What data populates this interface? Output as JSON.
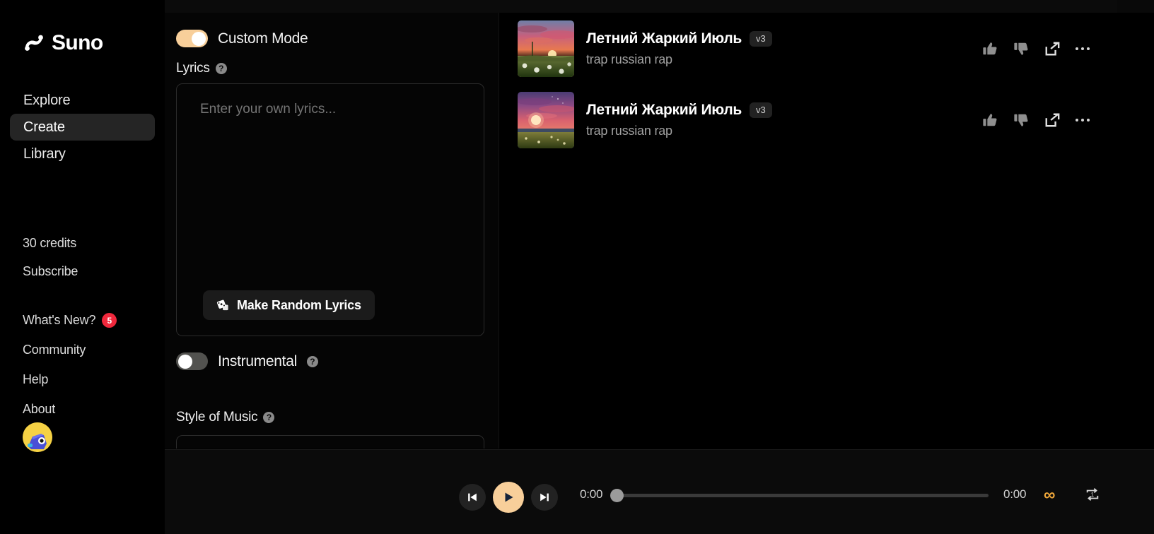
{
  "app": {
    "brand": "Suno"
  },
  "sidebar": {
    "nav": [
      {
        "label": "Explore",
        "active": false,
        "name": "explore"
      },
      {
        "label": "Create",
        "active": true,
        "name": "create"
      },
      {
        "label": "Library",
        "active": false,
        "name": "library"
      }
    ],
    "credits": "30 credits",
    "subscribe": "Subscribe",
    "links": [
      {
        "label": "What's New?",
        "badge": "5"
      },
      {
        "label": "Community",
        "badge": null
      },
      {
        "label": "Help",
        "badge": null
      },
      {
        "label": "About",
        "badge": null
      }
    ]
  },
  "create": {
    "custom_mode_label": "Custom Mode",
    "custom_mode_on": true,
    "lyrics_label": "Lyrics",
    "lyrics_value": "",
    "lyrics_placeholder": "Enter your own lyrics...",
    "random_lyrics_label": "Make Random Lyrics",
    "instrumental_label": "Instrumental",
    "instrumental_on": false,
    "style_label": "Style of Music",
    "style_value": "",
    "help_glyph": "?"
  },
  "results": {
    "songs": [
      {
        "title": "Летний Жаркий Июль",
        "style": "trap russian rap",
        "version": "v3",
        "art": "sunset-dandelion-field"
      },
      {
        "title": "Летний Жаркий Июль",
        "style": "trap russian rap",
        "version": "v3",
        "art": "purple-sunset-meadow"
      }
    ],
    "actions": {
      "like": "thumbs-up",
      "dislike": "thumbs-down",
      "share": "share",
      "more": "more-options"
    }
  },
  "player": {
    "current_time": "0:00",
    "total_time": "0:00",
    "progress_percent": 0,
    "playing": false,
    "infinity_glyph": "∞",
    "accent_color": "#f8cf9a",
    "infinity_color": "#f2a93b"
  }
}
